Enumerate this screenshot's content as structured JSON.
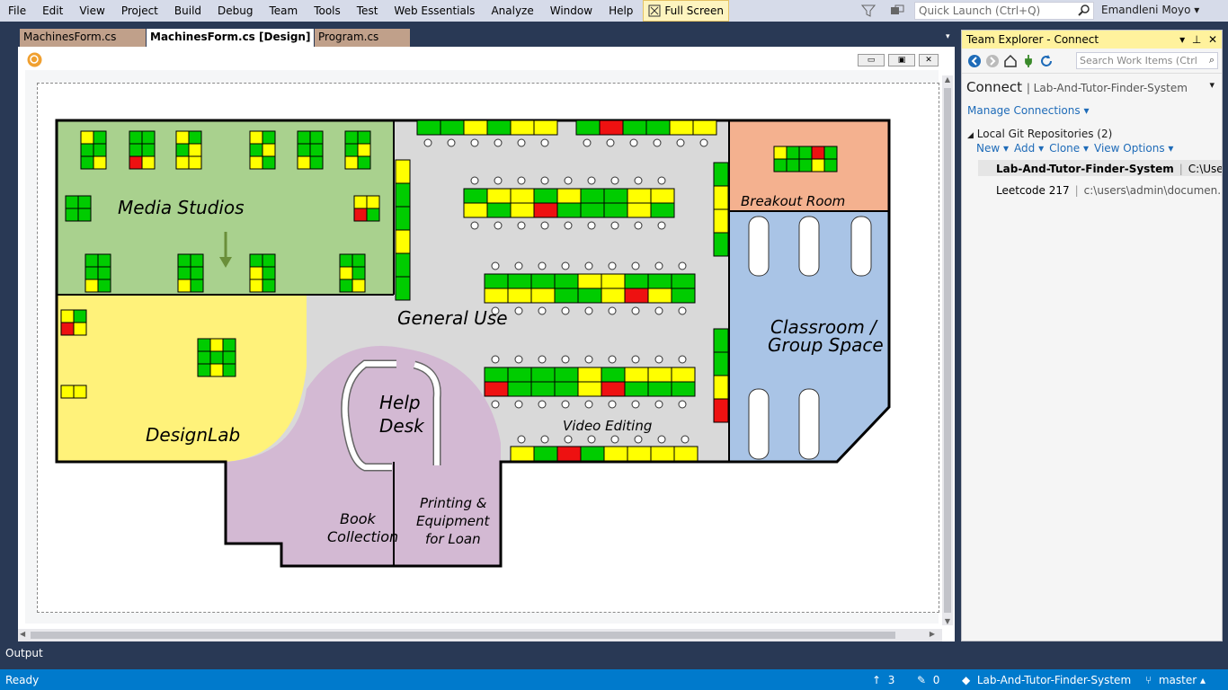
{
  "menu": [
    "File",
    "Edit",
    "View",
    "Project",
    "Build",
    "Debug",
    "Team",
    "Tools",
    "Test",
    "Web Essentials",
    "Analyze",
    "Window",
    "Help"
  ],
  "fullscreen_label": "Full Screen",
  "quick_launch_placeholder": "Quick Launch (Ctrl+Q)",
  "user_name": "Emandleni Moyo",
  "tabs": [
    {
      "label": "MachinesForm.cs"
    },
    {
      "label": "MachinesForm.cs [Design]"
    },
    {
      "label": "Program.cs"
    }
  ],
  "team_explorer": {
    "title": "Team Explorer - Connect",
    "search_placeholder": "Search Work Items (Ctrl",
    "connect_label": "Connect",
    "project_name": "Lab-And-Tutor-Finder-System",
    "manage_connections": "Manage Connections",
    "local_repos_header": "Local Git Repositories (2)",
    "actions": [
      "New",
      "Add",
      "Clone",
      "View Options"
    ],
    "repos": [
      {
        "name": "Lab-And-Tutor-Finder-System",
        "path": "C:\\Use..."
      },
      {
        "name": "Leetcode 217",
        "path": "c:\\users\\admin\\documen..."
      }
    ]
  },
  "floorplan": {
    "rooms": {
      "media_studios": "Media Studios",
      "general_use": "General Use",
      "designlab": "DesignLab",
      "help_desk_1": "Help",
      "help_desk_2": "Desk",
      "breakout_room": "Breakout Room",
      "classroom_1": "Classroom /",
      "classroom_2": "Group Space",
      "video_editing": "Video Editing",
      "book_1": "Book",
      "book_2": "Collection",
      "printing_1": "Printing &",
      "printing_2": "Equipment",
      "printing_3": "for Loan"
    },
    "colors": {
      "available": "#00cc00",
      "busy": "#ffff00",
      "offline": "#ee1111",
      "media_bg": "#a9d18e",
      "general_bg": "#d9d9d9",
      "design_bg": "#fff27a",
      "help_bg": "#d3b9d3",
      "breakout_bg": "#f4b18f",
      "classroom_bg": "#a9c4e6"
    }
  },
  "output_label": "Output",
  "status": {
    "ready": "Ready",
    "up_count": "3",
    "pending_count": "0",
    "repo": "Lab-And-Tutor-Finder-System",
    "branch": "master"
  }
}
